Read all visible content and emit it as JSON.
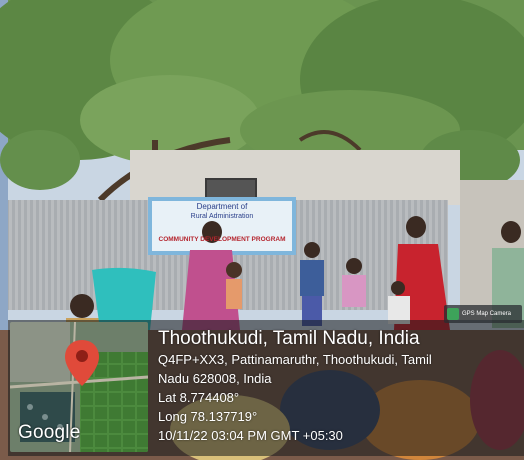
{
  "banner": {
    "line1": "Department of",
    "line2": "Rural Administration",
    "line3": "COMMUNITY DEVELOPMENT PROGRAM"
  },
  "map": {
    "provider": "Google",
    "pin_icon": "map-pin-icon"
  },
  "location": {
    "title": "Thoothukudi, Tamil Nadu, India",
    "address_line1": "Q4FP+XX3, Pattinamaruthr, Thoothukudi, Tamil",
    "address_line2": "Nadu 628008, India",
    "lat": "Lat 8.774408°",
    "long": "Long 78.137719°",
    "datetime": "10/11/22 03:04 PM GMT +05:30"
  },
  "badge": {
    "label": "GPS Map Camera",
    "icon": "gps-camera-icon"
  },
  "colors": {
    "sky": "#c9d6e3",
    "foliage": "#5f8a48",
    "wall": "#d9d6cf",
    "fence": "#b9bcbf",
    "banner": "#7fb6dc",
    "pin": "#e04a3a"
  }
}
